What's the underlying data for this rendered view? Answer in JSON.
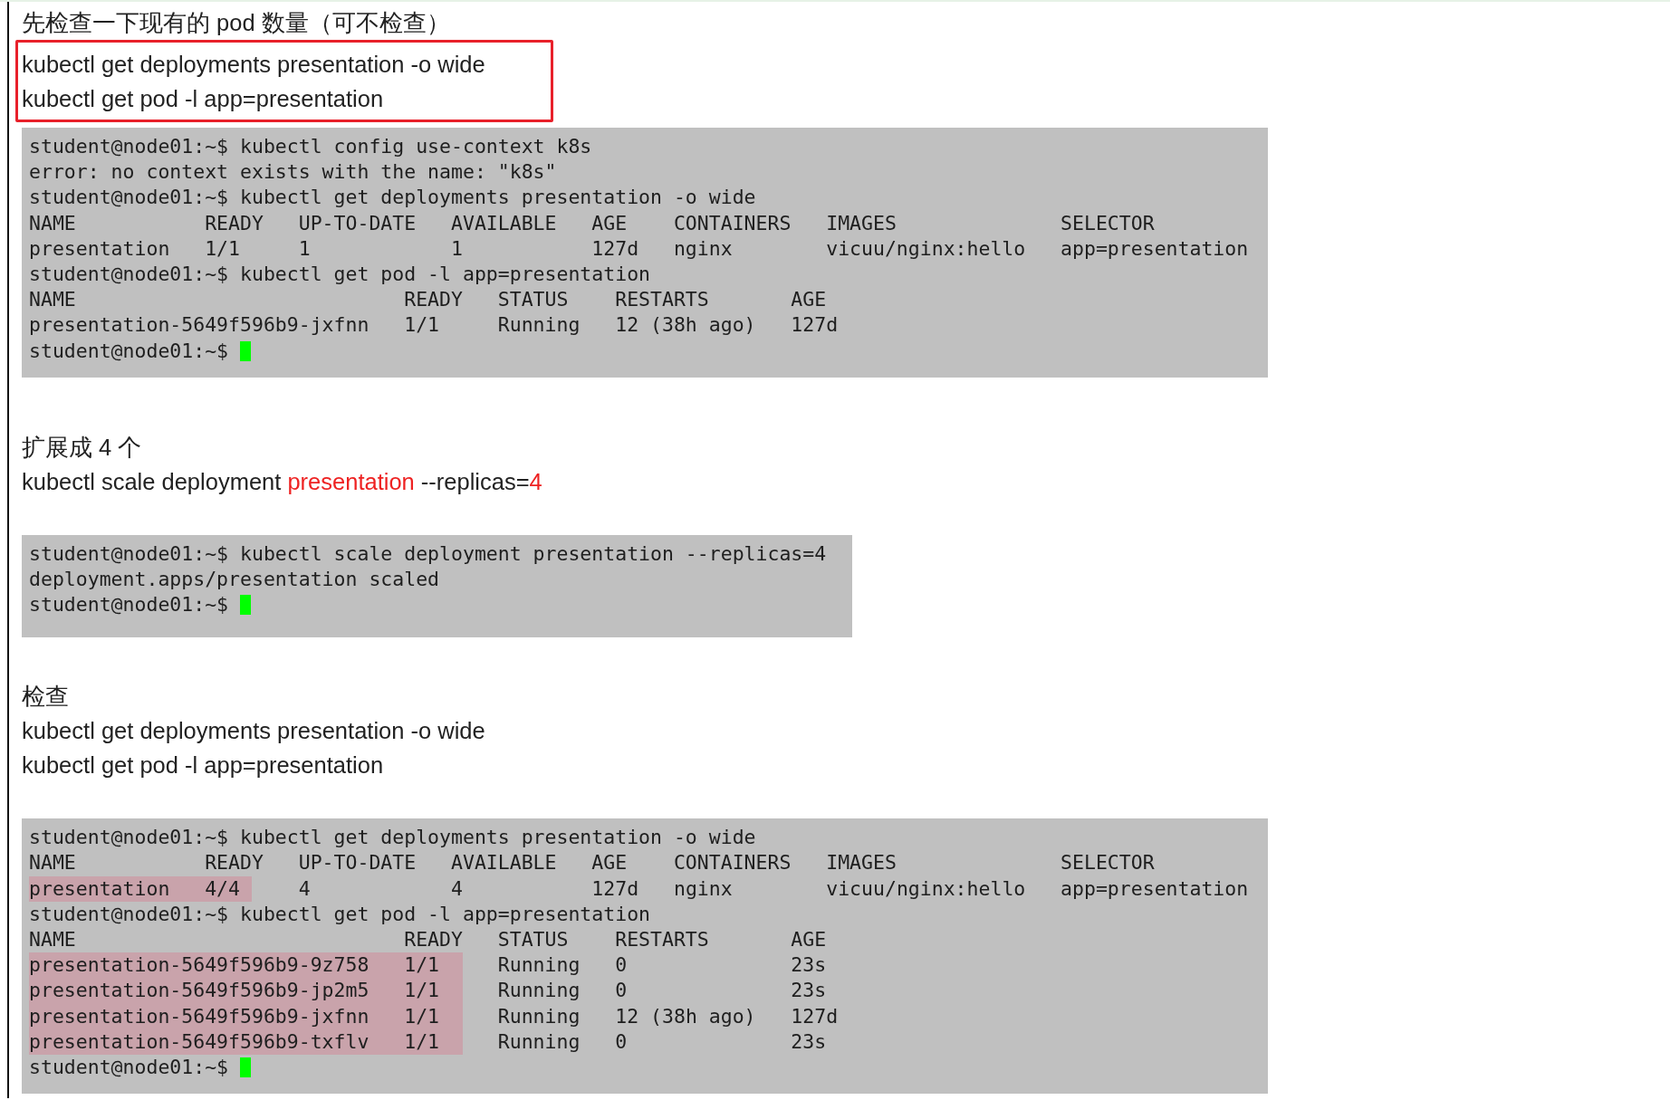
{
  "blocks": [
    {
      "kind": "heading",
      "text": "先检查一下现有的 pod 数量（可不检查）"
    },
    {
      "kind": "boxed",
      "lines": [
        "kubectl get deployments presentation -o wide",
        "kubectl get pod -l app=presentation"
      ]
    },
    {
      "kind": "terminal",
      "lines": [
        {
          "text": "student@node01:~$ kubectl config use-context k8s",
          "cursor": false
        },
        {
          "text": "error: no context exists with the name: \"k8s\"",
          "cursor": false
        },
        {
          "text": "student@node01:~$ kubectl get deployments presentation -o wide",
          "cursor": false
        },
        {
          "text": "NAME           READY   UP-TO-DATE   AVAILABLE   AGE    CONTAINERS   IMAGES              SELECTOR",
          "cursor": false
        },
        {
          "text": "presentation   1/1     1            1           127d   nginx        vicuu/nginx:hello   app=presentation",
          "cursor": false
        },
        {
          "text": "student@node01:~$ kubectl get pod -l app=presentation",
          "cursor": false
        },
        {
          "text": "NAME                            READY   STATUS    RESTARTS       AGE",
          "cursor": false
        },
        {
          "text": "presentation-5649f596b9-jxfnn   1/1     Running   12 (38h ago)   127d",
          "cursor": false
        },
        {
          "text": "student@node01:~$ ",
          "cursor": true
        }
      ]
    },
    {
      "kind": "heading",
      "text": "扩展成 4 个"
    },
    {
      "kind": "colored",
      "segments": [
        {
          "text": "kubectl scale deployment ",
          "color": "#222222"
        },
        {
          "text": "presentation",
          "color": "#ee2222"
        },
        {
          "text": " --replicas=",
          "color": "#222222"
        },
        {
          "text": "4",
          "color": "#ee2222"
        }
      ]
    },
    {
      "kind": "terminal",
      "lines": [
        {
          "text": "student@node01:~$ kubectl scale deployment presentation --replicas=4",
          "cursor": false
        },
        {
          "text": "deployment.apps/presentation scaled",
          "cursor": false
        },
        {
          "text": "student@node01:~$ ",
          "cursor": true
        }
      ]
    },
    {
      "kind": "heading",
      "text": "检查"
    },
    {
      "kind": "plain",
      "text": "kubectl get deployments presentation -o wide"
    },
    {
      "kind": "plain",
      "text": "kubectl get pod -l app=presentation"
    },
    {
      "kind": "terminal",
      "lines": [
        {
          "text": "student@node01:~$ kubectl get deployments presentation -o wide",
          "cursor": false
        },
        {
          "text": "NAME           READY   UP-TO-DATE   AVAILABLE   AGE    CONTAINERS   IMAGES              SELECTOR",
          "cursor": false
        },
        {
          "marked": "presentation   4/4 ",
          "text": "    4            4           127d   nginx        vicuu/nginx:hello   app=presentation",
          "cursor": false
        },
        {
          "text": "student@node01:~$ kubectl get pod -l app=presentation",
          "cursor": false
        },
        {
          "text": "NAME                            READY   STATUS    RESTARTS       AGE",
          "cursor": false
        },
        {
          "marked": "presentation-5649f596b9-9z758   1/1  ",
          "text": "   Running   0              23s",
          "cursor": false
        },
        {
          "marked": "presentation-5649f596b9-jp2m5   1/1  ",
          "text": "   Running   0              23s",
          "cursor": false
        },
        {
          "marked": "presentation-5649f596b9-jxfnn   1/1  ",
          "text": "   Running   12 (38h ago)   127d",
          "cursor": false
        },
        {
          "marked": "presentation-5649f596b9-txflv   1/1  ",
          "text": "   Running   0              23s",
          "cursor": false
        },
        {
          "text": "student@node01:~$ ",
          "cursor": true
        }
      ]
    }
  ]
}
